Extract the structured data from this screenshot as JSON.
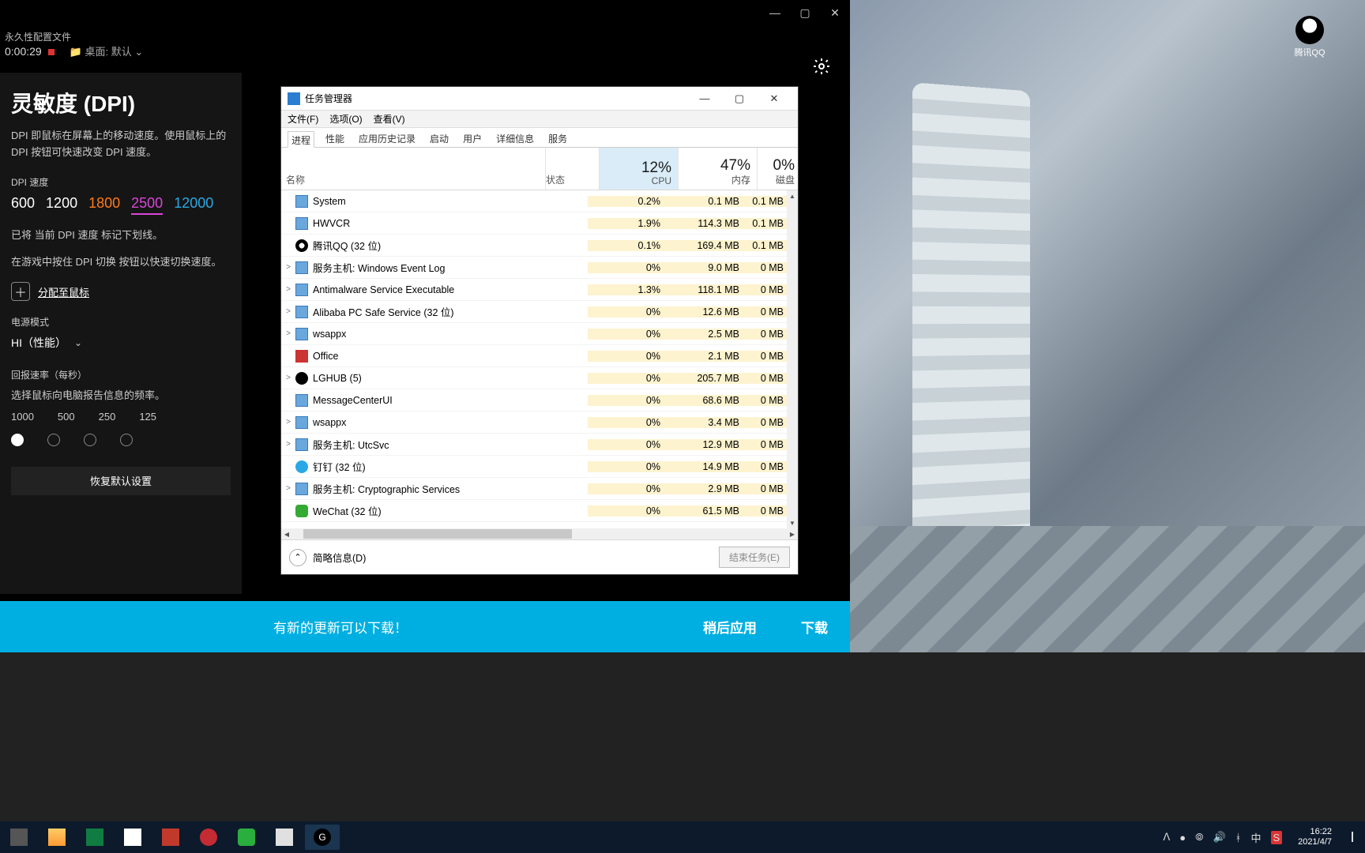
{
  "app": {
    "perma": "永久性配置文件",
    "timer": "0:00:29",
    "desktop_prefix": "桌面:",
    "desktop_value": "默认",
    "title": "灵敏度 (DPI)",
    "desc": "DPI 即鼠标在屏幕上的移动速度。使用鼠标上的 DPI 按钮可快速改变 DPI 速度。",
    "dpi_speed_label": "DPI 速度",
    "dpi_values": {
      "v1": "600",
      "v2": "1200",
      "v3": "1800",
      "v4": "2500",
      "v5": "12000"
    },
    "note1": "已将 当前 DPI 速度 标记下划线。",
    "note2": "在游戏中按住 DPI 切换 按钮以快速切换速度。",
    "assign": "分配至鼠标",
    "power_label": "电源模式",
    "power_value": "HI（性能）",
    "rate_label": "回报速率（每秒）",
    "rate_desc": "选择鼠标向电脑报告信息的频率。",
    "rates": {
      "r1": "1000",
      "r2": "500",
      "r3": "250",
      "r4": "125"
    },
    "restore": "恢复默认设置"
  },
  "banner": {
    "msg": "有新的更新可以下载！",
    "later": "稍后应用",
    "download": "下载"
  },
  "tm": {
    "title": "任务管理器",
    "menu": {
      "file": "文件(F)",
      "options": "选项(O)",
      "view": "查看(V)"
    },
    "tabs": {
      "proc": "进程",
      "perf": "性能",
      "hist": "应用历史记录",
      "startup": "启动",
      "users": "用户",
      "details": "详细信息",
      "services": "服务"
    },
    "cols": {
      "name": "名称",
      "status": "状态",
      "cpu_pct": "12%",
      "cpu": "CPU",
      "mem_pct": "47%",
      "mem": "内存",
      "disk_pct": "0%",
      "disk": "磁盘"
    },
    "rows": [
      {
        "exp": "",
        "icon": "",
        "name": "System",
        "cpu": "0.2%",
        "mem": "0.1 MB",
        "disk": "0.1 MB"
      },
      {
        "exp": "",
        "icon": "",
        "name": "HWVCR",
        "cpu": "1.9%",
        "mem": "114.3 MB",
        "disk": "0.1 MB"
      },
      {
        "exp": "",
        "icon": "qq",
        "name": "腾讯QQ (32 位)",
        "cpu": "0.1%",
        "mem": "169.4 MB",
        "disk": "0.1 MB"
      },
      {
        "exp": ">",
        "icon": "",
        "name": "服务主机: Windows Event Log",
        "cpu": "0%",
        "mem": "9.0 MB",
        "disk": "0 MB"
      },
      {
        "exp": ">",
        "icon": "",
        "name": "Antimalware Service Executable",
        "cpu": "1.3%",
        "mem": "118.1 MB",
        "disk": "0 MB"
      },
      {
        "exp": ">",
        "icon": "",
        "name": "Alibaba PC Safe Service (32 位)",
        "cpu": "0%",
        "mem": "12.6 MB",
        "disk": "0 MB"
      },
      {
        "exp": ">",
        "icon": "",
        "name": "wsappx",
        "cpu": "0%",
        "mem": "2.5 MB",
        "disk": "0 MB"
      },
      {
        "exp": "",
        "icon": "o",
        "name": "Office",
        "cpu": "0%",
        "mem": "2.1 MB",
        "disk": "0 MB"
      },
      {
        "exp": ">",
        "icon": "g",
        "name": "LGHUB (5)",
        "cpu": "0%",
        "mem": "205.7 MB",
        "disk": "0 MB"
      },
      {
        "exp": "",
        "icon": "",
        "name": "MessageCenterUI",
        "cpu": "0%",
        "mem": "68.6 MB",
        "disk": "0 MB"
      },
      {
        "exp": ">",
        "icon": "",
        "name": "wsappx",
        "cpu": "0%",
        "mem": "3.4 MB",
        "disk": "0 MB"
      },
      {
        "exp": ">",
        "icon": "",
        "name": "服务主机: UtcSvc",
        "cpu": "0%",
        "mem": "12.9 MB",
        "disk": "0 MB"
      },
      {
        "exp": "",
        "icon": "d",
        "name": "钉钉 (32 位)",
        "cpu": "0%",
        "mem": "14.9 MB",
        "disk": "0 MB"
      },
      {
        "exp": ">",
        "icon": "",
        "name": "服务主机: Cryptographic Services",
        "cpu": "0%",
        "mem": "2.9 MB",
        "disk": "0 MB"
      },
      {
        "exp": "",
        "icon": "w",
        "name": "WeChat (32 位)",
        "cpu": "0%",
        "mem": "61.5 MB",
        "disk": "0 MB"
      }
    ],
    "footer_lbl": "简略信息(D)",
    "end_task": "结束任务(E)"
  },
  "desktop": {
    "qq_label": "腾讯QQ"
  },
  "tray": {
    "ime": "中",
    "time": "16:22",
    "date": "2021/4/7"
  }
}
